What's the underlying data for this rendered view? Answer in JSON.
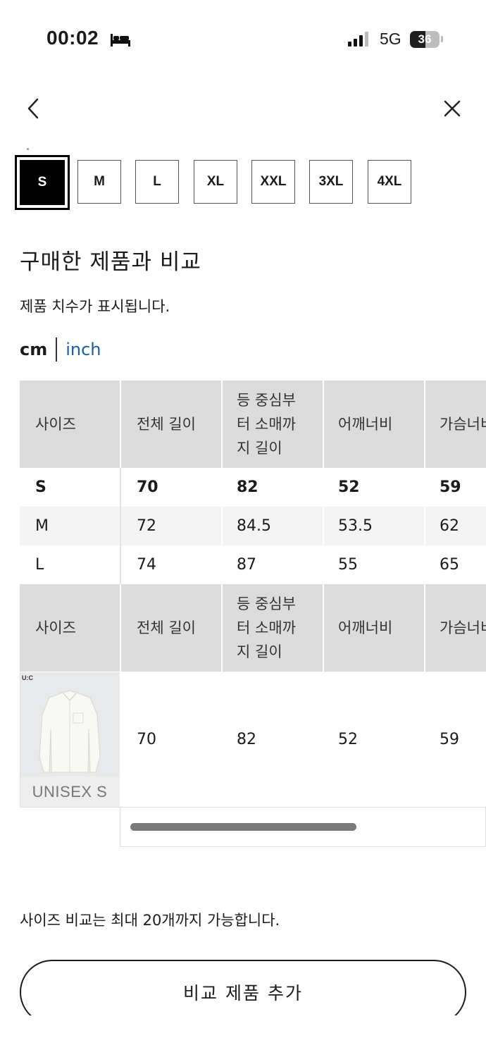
{
  "status_bar": {
    "time": "00:02",
    "network": "5G",
    "battery": "36"
  },
  "size_selector": {
    "options": [
      "S",
      "M",
      "L",
      "XL",
      "XXL",
      "3XL",
      "4XL"
    ],
    "selected": "S"
  },
  "compare": {
    "title": "구매한 제품과 비교",
    "subtitle": "제품 치수가 표시됩니다."
  },
  "units": {
    "cm": "cm",
    "inch": "inch",
    "selected": "cm"
  },
  "size_table": {
    "headers": [
      "사이즈",
      "전체 길이",
      "등 중심부\n터 소매까\n지 길이",
      "어깨너비",
      "가슴너비"
    ],
    "rows": [
      [
        "S",
        "70",
        "82",
        "52",
        "59"
      ],
      [
        "M",
        "72",
        "84.5",
        "53.5",
        "62"
      ],
      [
        "L",
        "74",
        "87",
        "55",
        "65"
      ]
    ]
  },
  "purchased_table": {
    "headers": [
      "사이즈",
      "전체 길이",
      "등 중심부\n터 소매까\n지 길이",
      "어깨너비",
      "가슴너비"
    ],
    "product": {
      "brand_mark": "U:C",
      "caption": "UNISEX S",
      "values": [
        "70",
        "82",
        "52",
        "59"
      ]
    }
  },
  "footer": {
    "limit_note": "사이즈 비교는 최대 20개까지 가능합니다.",
    "add_button": "비교 제품 추가"
  },
  "colors": {
    "accent_link": "#1a5fa6",
    "header_bg": "#dcdcdc",
    "selected_chip": "#000000"
  }
}
